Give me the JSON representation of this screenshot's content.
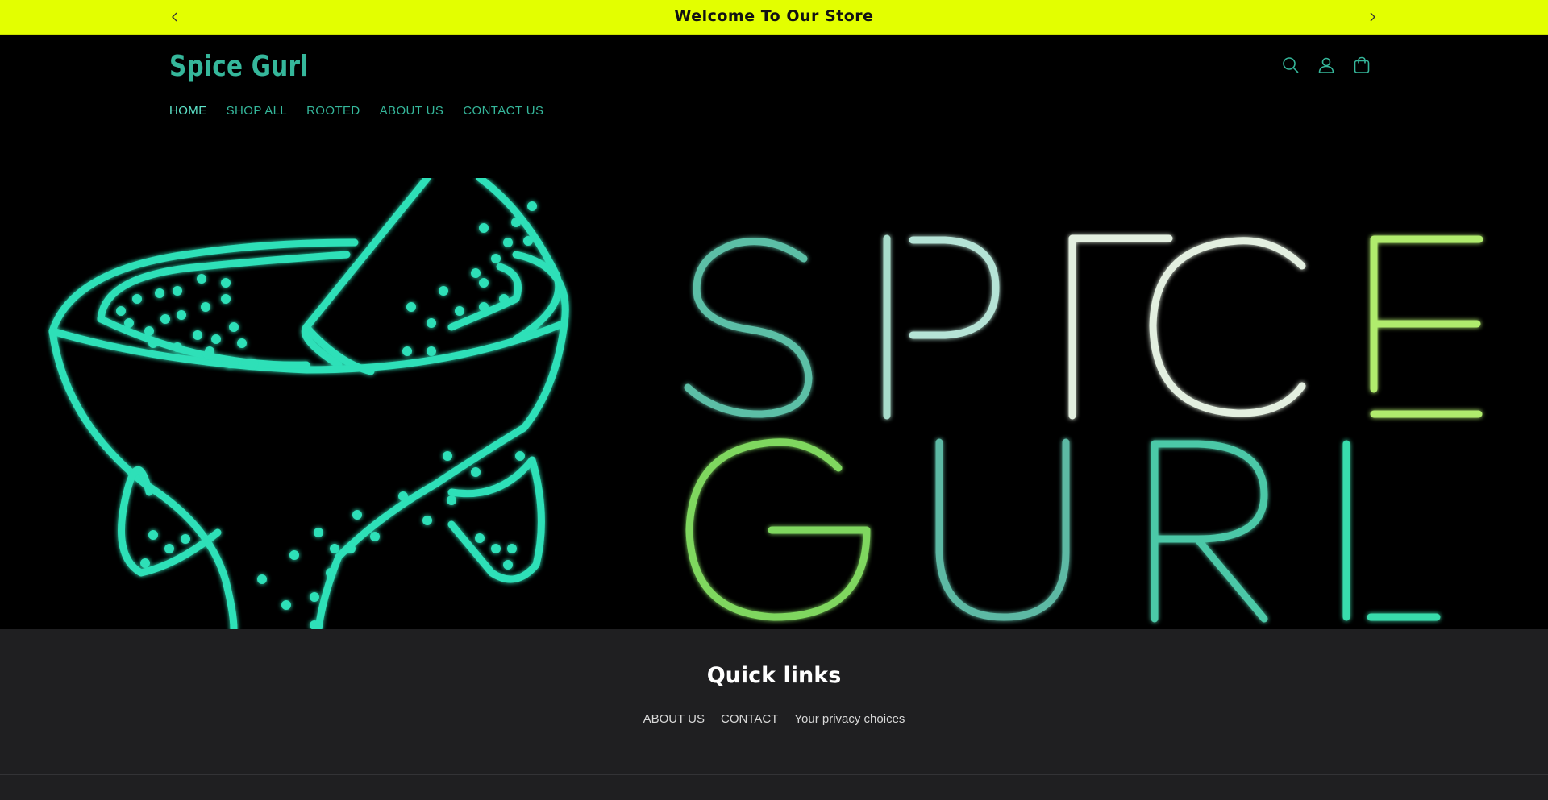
{
  "announcement": {
    "text": "Welcome To Our Store",
    "prev_icon": "chevron-left-icon",
    "next_icon": "chevron-right-icon"
  },
  "header": {
    "logo": "Spice Gurl",
    "icons": [
      "search-icon",
      "account-icon",
      "cart-icon"
    ],
    "nav": [
      {
        "label": "HOME",
        "active": true
      },
      {
        "label": "SHOP ALL",
        "active": false
      },
      {
        "label": "ROOTED",
        "active": false
      },
      {
        "label": "ABOUT US",
        "active": false
      },
      {
        "label": "CONTACT US",
        "active": false
      }
    ]
  },
  "hero": {
    "image": "spice-gurl-neon-logo",
    "logo_text_line1": "SPICE",
    "logo_text_line2": "GURL"
  },
  "footer": {
    "heading": "Quick links",
    "links": [
      "ABOUT US",
      "CONTACT",
      "Your privacy choices"
    ]
  },
  "colors": {
    "announcement_bg": "#e3ff00",
    "brand_green": "#35b79b",
    "neon_teal": "#2de0b8",
    "footer_bg": "#1f1f21"
  }
}
